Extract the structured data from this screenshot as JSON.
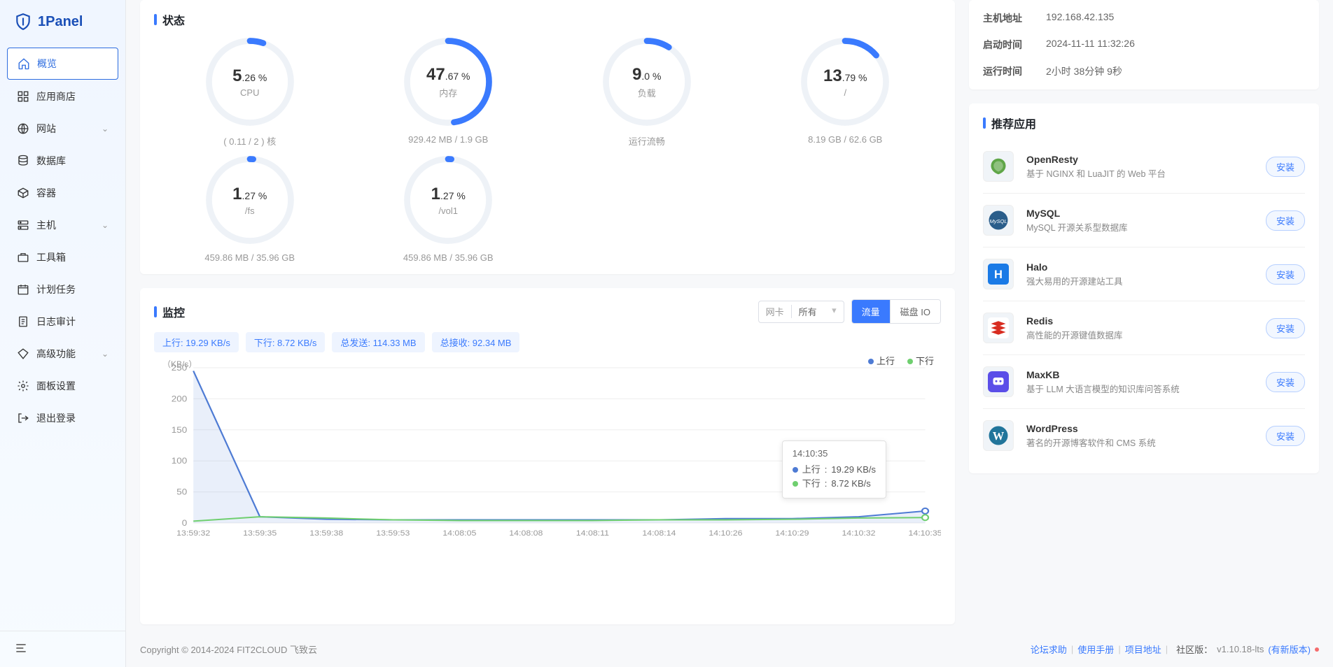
{
  "brand": "1Panel",
  "nav": {
    "items": [
      {
        "label": "概览",
        "active": true,
        "icon": "home"
      },
      {
        "label": "应用商店",
        "icon": "grid"
      },
      {
        "label": "网站",
        "icon": "globe",
        "chevron": true
      },
      {
        "label": "数据库",
        "icon": "database"
      },
      {
        "label": "容器",
        "icon": "container"
      },
      {
        "label": "主机",
        "icon": "server",
        "chevron": true
      },
      {
        "label": "工具箱",
        "icon": "toolbox"
      },
      {
        "label": "计划任务",
        "icon": "calendar"
      },
      {
        "label": "日志审计",
        "icon": "log"
      },
      {
        "label": "高级功能",
        "icon": "diamond",
        "chevron": true
      },
      {
        "label": "面板设置",
        "icon": "gear"
      },
      {
        "label": "退出登录",
        "icon": "logout"
      }
    ]
  },
  "status": {
    "title": "状态",
    "gauges": [
      {
        "big": "5",
        "small": ".26 %",
        "pct": 5.26,
        "label": "CPU",
        "sub": "( 0.11 / 2 ) 核"
      },
      {
        "big": "47",
        "small": ".67 %",
        "pct": 47.67,
        "label": "内存",
        "sub": "929.42 MB / 1.9 GB"
      },
      {
        "big": "9",
        "small": ".0 %",
        "pct": 9.0,
        "label": "负载",
        "sub": "运行流畅"
      },
      {
        "big": "13",
        "small": ".79 %",
        "pct": 13.79,
        "label": "/",
        "sub": "8.19 GB / 62.6 GB"
      },
      {
        "big": "1",
        "small": ".27 %",
        "pct": 1.27,
        "label": "/fs",
        "sub": "459.86 MB / 35.96 GB"
      },
      {
        "big": "1",
        "small": ".27 %",
        "pct": 1.27,
        "label": "/vol1",
        "sub": "459.86 MB / 35.96 GB"
      }
    ]
  },
  "monitor": {
    "title": "监控",
    "select_label": "网卡",
    "select_value": "所有",
    "tabs": [
      {
        "label": "流量",
        "active": true
      },
      {
        "label": "磁盘 IO",
        "active": false
      }
    ],
    "tags": [
      "上行: 19.29 KB/s",
      "下行: 8.72 KB/s",
      "总发送: 114.33 MB",
      "总接收: 92.34 MB"
    ],
    "ylabel": "（KB/s）",
    "legend": [
      {
        "name": "上行",
        "color": "#4e7bd4"
      },
      {
        "name": "下行",
        "color": "#6fcf6f"
      }
    ],
    "tooltip": {
      "time": "14:10:35",
      "rows": [
        {
          "name": "上行",
          "value": "19.29 KB/s",
          "color": "#4e7bd4"
        },
        {
          "name": "下行",
          "value": "8.72 KB/s",
          "color": "#6fcf6f"
        }
      ]
    }
  },
  "sysinfo": {
    "rows": [
      {
        "lbl": "主机地址",
        "val": "192.168.42.135"
      },
      {
        "lbl": "启动时间",
        "val": "2024-11-11 11:32:26"
      },
      {
        "lbl": "运行时间",
        "val": "2小时 38分钟 9秒"
      }
    ]
  },
  "recommend": {
    "title": "推荐应用",
    "install_label": "安装",
    "apps": [
      {
        "name": "OpenResty",
        "desc": "基于 NGINX 和 LuaJIT 的 Web 平台",
        "icon": "openresty"
      },
      {
        "name": "MySQL",
        "desc": "MySQL 开源关系型数据库",
        "icon": "mysql"
      },
      {
        "name": "Halo",
        "desc": "强大易用的开源建站工具",
        "icon": "halo"
      },
      {
        "name": "Redis",
        "desc": "高性能的开源键值数据库",
        "icon": "redis"
      },
      {
        "name": "MaxKB",
        "desc": "基于 LLM 大语言模型的知识库问答系统",
        "icon": "maxkb"
      },
      {
        "name": "WordPress",
        "desc": "著名的开源博客软件和 CMS 系统",
        "icon": "wordpress"
      }
    ]
  },
  "footer": {
    "copyright": "Copyright © 2014-2024 FIT2CLOUD 飞致云",
    "links": [
      "论坛求助",
      "使用手册",
      "项目地址"
    ],
    "version_label": "社区版：",
    "version": "v1.10.18-lts",
    "new_version": "(有新版本)"
  },
  "chart_data": {
    "type": "line",
    "xlabel": "",
    "ylabel": "KB/s",
    "ylim": [
      0,
      250
    ],
    "yticks": [
      0,
      50,
      100,
      150,
      200,
      250
    ],
    "legend_position": "top-right",
    "categories": [
      "13:59:32",
      "13:59:35",
      "13:59:38",
      "13:59:53",
      "14:08:05",
      "14:08:08",
      "14:08:11",
      "14:08:14",
      "14:10:26",
      "14:10:29",
      "14:10:32",
      "14:10:35"
    ],
    "series": [
      {
        "name": "上行",
        "color": "#4e7bd4",
        "values": [
          245,
          10,
          6,
          5,
          5,
          5,
          5,
          5,
          7,
          7,
          10,
          19.29
        ]
      },
      {
        "name": "下行",
        "color": "#6fcf6f",
        "values": [
          3,
          10,
          8,
          5,
          4,
          4,
          4,
          5,
          5,
          6,
          8,
          8.72
        ]
      }
    ]
  }
}
